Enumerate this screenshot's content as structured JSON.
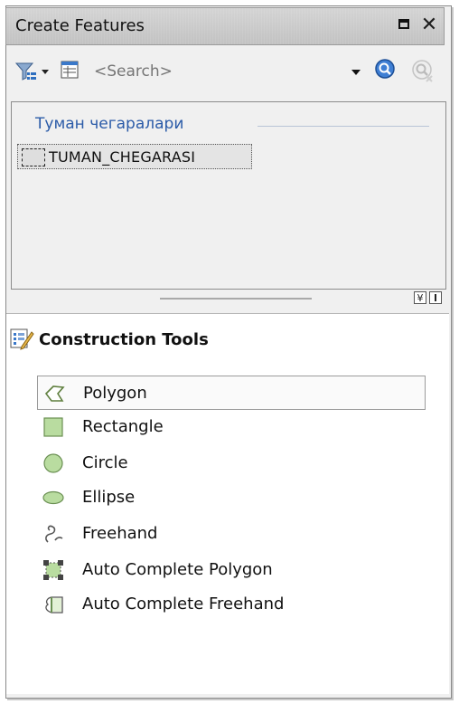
{
  "window": {
    "title": "Create Features"
  },
  "toolbar": {
    "search_placeholder": "<Search>"
  },
  "templates": {
    "group_name": "Туман чегаралари",
    "items": [
      {
        "label": "TUMAN_CHEGARASI"
      }
    ]
  },
  "tools": {
    "header": "Construction Tools",
    "items": [
      {
        "label": "Polygon",
        "icon": "polygon-icon",
        "selected": true
      },
      {
        "label": "Rectangle",
        "icon": "rectangle-icon",
        "selected": false
      },
      {
        "label": "Circle",
        "icon": "circle-icon",
        "selected": false
      },
      {
        "label": "Ellipse",
        "icon": "ellipse-icon",
        "selected": false
      },
      {
        "label": "Freehand",
        "icon": "freehand-icon",
        "selected": false
      },
      {
        "label": "Auto Complete Polygon",
        "icon": "auto-complete-polygon-icon",
        "selected": false
      },
      {
        "label": "Auto Complete Freehand",
        "icon": "auto-complete-freehand-icon",
        "selected": false
      }
    ]
  },
  "colors": {
    "group_header": "#2b5ba8",
    "shape_fill": "#b9dca0",
    "shape_stroke": "#6a8f52"
  }
}
